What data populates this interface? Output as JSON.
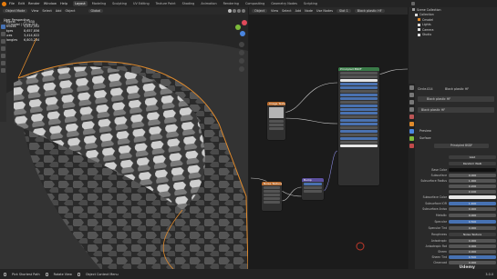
{
  "menu": [
    "File",
    "Edit",
    "Render",
    "Window",
    "Help"
  ],
  "workspaces": [
    "Layout",
    "Modeling",
    "Sculpting",
    "UV Editing",
    "Texture Paint",
    "Shading",
    "Animation",
    "Rendering",
    "Compositing",
    "Geometry Nodes",
    "Scripting"
  ],
  "active_workspace": "Layout",
  "scene": "Scene",
  "view_layer": "ViewLayer",
  "viewport": {
    "mode": "Object Mode",
    "view": "View",
    "select": "Select",
    "add": "Add",
    "object": "Object",
    "transform": "Global",
    "overlay_title": "User Perspective",
    "overlay_subtitle": "(1) Cmodel | Circle.014",
    "stats": [
      {
        "k": "Objects",
        "v": "1 / 630"
      },
      {
        "k": "Vertices",
        "v": "5,632,352"
      },
      {
        "k": "Edges",
        "v": "8,657,856"
      },
      {
        "k": "Faces",
        "v": "3,414,622"
      },
      {
        "k": "Triangles",
        "v": "6,803,234"
      }
    ]
  },
  "node_editor": {
    "object": "Object",
    "view": "View",
    "select": "Select",
    "add": "Add",
    "node": "Node",
    "use_nodes": "Use Nodes",
    "slot": "Slot 1",
    "material": "Black plastic HF",
    "nodes": {
      "principled": "Principled BSDF",
      "texture": "Image Texture",
      "bump": "Bump",
      "mapping": "Noise Texture",
      "output": "Material Output"
    }
  },
  "outliner": {
    "title": "Scene Collection",
    "items": [
      "Collection",
      "Cmodel",
      "Lights",
      "Camera",
      "Studio"
    ]
  },
  "properties": {
    "object_name": "Circle.014",
    "material_slot": "Black plastic HF",
    "material_name": "Black plastic HF",
    "preview": "Preview",
    "surface": "Surface",
    "surface_type": "Principled BSDF",
    "rows": [
      {
        "label": "",
        "value": "GGX"
      },
      {
        "label": "",
        "value": "Random Walk"
      },
      {
        "label": "Base Color",
        "value": ""
      },
      {
        "label": "Subsurface",
        "value": "0.000"
      },
      {
        "label": "Subsurface Radius",
        "value": "1.000"
      },
      {
        "label": "",
        "value": "0.200"
      },
      {
        "label": "",
        "value": "0.100"
      },
      {
        "label": "Subsurface Color",
        "value": ""
      },
      {
        "label": "Subsurface IOR",
        "value": "1.400"
      },
      {
        "label": "Subsurface Aniso",
        "value": "0.000"
      },
      {
        "label": "Metallic",
        "value": "0.000"
      },
      {
        "label": "Specular",
        "value": "0.500"
      },
      {
        "label": "Specular Tint",
        "value": "0.000"
      },
      {
        "label": "Roughness",
        "value": "Noise Texture"
      },
      {
        "label": "Anisotropic",
        "value": "0.000"
      },
      {
        "label": "Anisotropic Rot",
        "value": "0.000"
      },
      {
        "label": "Sheen",
        "value": "0.000"
      },
      {
        "label": "Sheen Tint",
        "value": "0.500"
      },
      {
        "label": "Clearcoat",
        "value": "0.000"
      }
    ]
  },
  "status": {
    "left": "Pick Shortest Path",
    "mid": "Rotate View",
    "right": "Object Context Menu",
    "version": "3.0.0"
  },
  "watermark": "Udemy"
}
